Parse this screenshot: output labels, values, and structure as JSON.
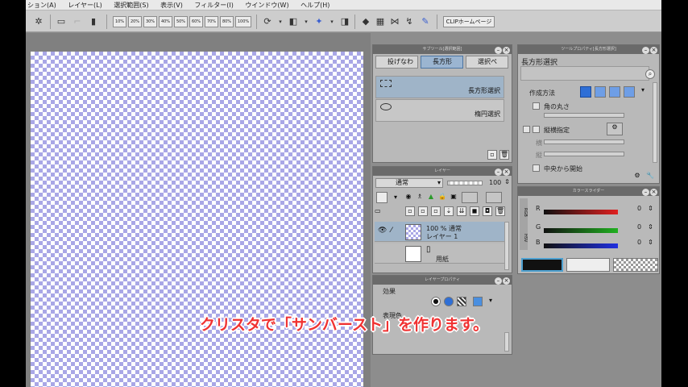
{
  "menu": {
    "items": [
      "ション(A)",
      "レイヤー(L)",
      "選択範囲(S)",
      "表示(V)",
      "フィルター(I)",
      "ウインドウ(W)",
      "ヘルプ(H)"
    ]
  },
  "toolbar": {
    "zoom_buttons": [
      "10%",
      "20%",
      "30%",
      "40%",
      "50%",
      "60%",
      "70%",
      "80%",
      "100%"
    ],
    "clip_home_label": "CLIPホームページ"
  },
  "subtool_panel": {
    "title": "サブツール[選択範囲]",
    "tabs": [
      "投げなわ",
      "長方形",
      "選択ペ"
    ],
    "items": [
      {
        "label": "長方形選択",
        "selected": true
      },
      {
        "label": "楕円選択",
        "selected": false
      }
    ]
  },
  "tool_property_panel": {
    "title": "ツールプロパティ[長方形選択]",
    "tool_name": "長方形選択",
    "creation_method_label": "作成方法",
    "rounded_corners_label": "角の丸さ",
    "aspect_label": "縦横指定",
    "width_label": "横",
    "height_label": "縦",
    "center_label": "中央から開始"
  },
  "layer_panel": {
    "title": "レイヤー",
    "blend_mode": "通常",
    "opacity": "100",
    "layers": [
      {
        "line1": "100 % 通常",
        "line2": "レイヤー 1",
        "selected": true
      },
      {
        "line1": "",
        "line2": "用紙",
        "selected": false
      }
    ]
  },
  "color_slider_panel": {
    "title": "カラースライダー",
    "side_tabs": [
      "RGB",
      "HSV"
    ],
    "channels": [
      {
        "name": "R",
        "value": "0",
        "color": "#e02020"
      },
      {
        "name": "G",
        "value": "0",
        "color": "#20b020"
      },
      {
        "name": "B",
        "value": "0",
        "color": "#2030e0"
      }
    ],
    "main_color": "#111111",
    "sub_color": "#eeeeee"
  },
  "layer_property_panel": {
    "title": "レイヤープロパティ",
    "effect_label": "効果",
    "expression_color_label": "表現色"
  },
  "caption": {
    "text": "クリスタで「サンバースト」を作ります。"
  }
}
